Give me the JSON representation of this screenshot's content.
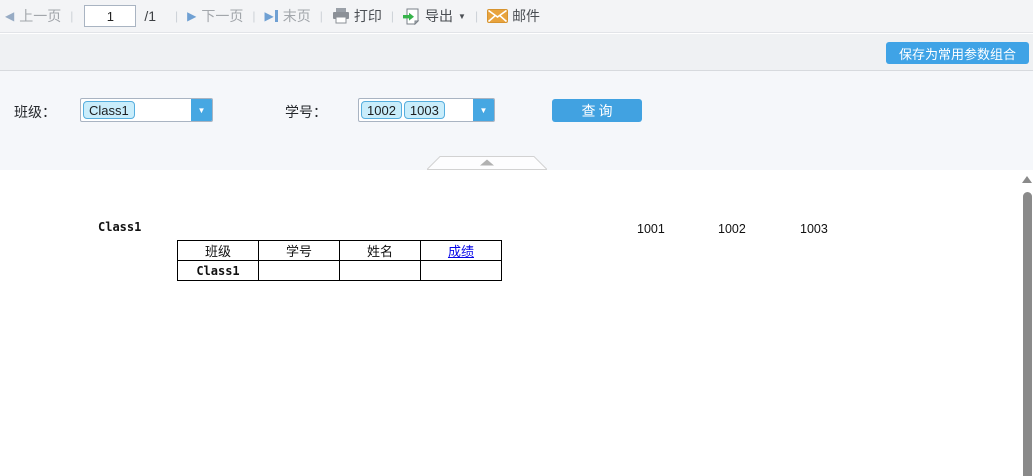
{
  "toolbar": {
    "prev_label": "上一页",
    "page_value": "1",
    "total_pages": "/1",
    "next_label": "下一页",
    "last_label": "末页",
    "print_label": "打印",
    "export_label": "导出",
    "mail_label": "邮件"
  },
  "actions": {
    "save_label": "保存为常用参数组合"
  },
  "params": {
    "class_label": "班级：",
    "class_tags": [
      "Class1"
    ],
    "student_label": "学号：",
    "student_tags": [
      "1002",
      "1003"
    ],
    "query_label": "查询"
  },
  "report": {
    "left_text": "Class1",
    "table": {
      "headers": [
        "班级",
        "学号",
        "姓名",
        "成绩"
      ],
      "row": [
        "Class1",
        "",
        "",
        ""
      ]
    },
    "right_values": [
      "1001",
      "1002",
      "1003"
    ]
  },
  "icons": {
    "prev": "left-triangle",
    "next": "right-triangle",
    "last": "right-triangle-bar",
    "print": "printer",
    "export": "document-green-arrow",
    "mail": "orange-envelope",
    "combo": "down-caret",
    "collapse": "up-triangle-trapezoid"
  },
  "colors": {
    "accent_blue": "#41a2e1",
    "toolbar_bg": "#f3f4f6",
    "panel_bg": "#f5f7fa",
    "tag_bg": "#c9edfb",
    "tag_border": "#56aede",
    "link_blue": "#0606e8",
    "nav_grey": "#a2a6ab",
    "scroll_grey": "#8a8a8a",
    "mail_orange": "#e8a33d",
    "export_green": "#36b34a"
  }
}
